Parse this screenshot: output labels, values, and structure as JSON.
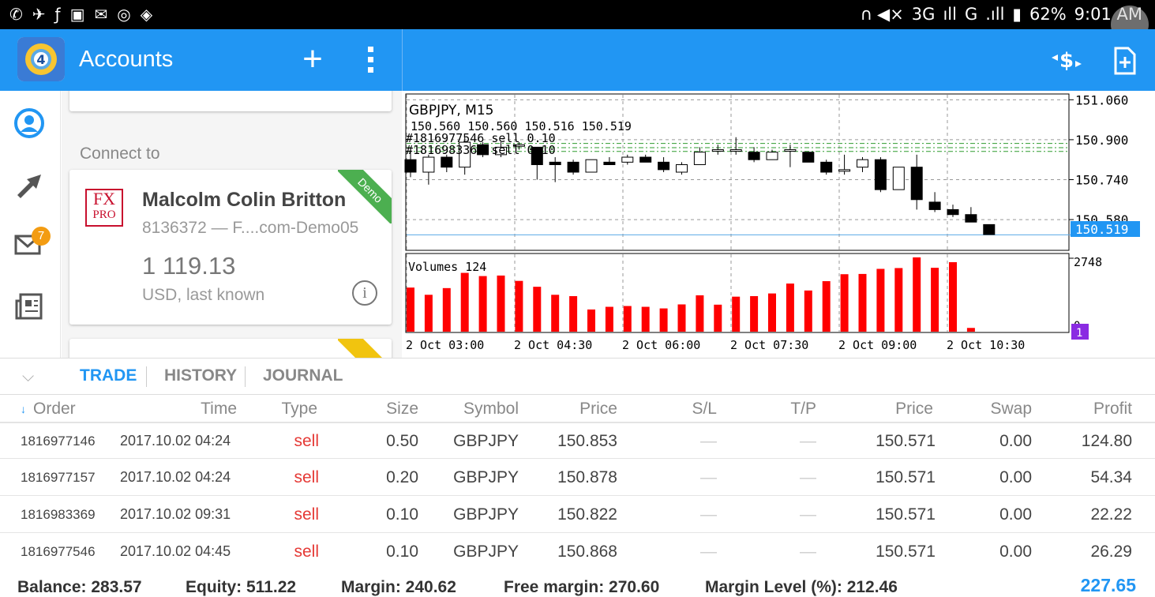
{
  "status_bar": {
    "left_icons": [
      "whatsapp-icon",
      "twitter-bird-icon",
      "fa-icon",
      "facebook-icon",
      "mail-icon",
      "instagram-icon",
      "app-icon"
    ],
    "network": "3G",
    "signal": "G",
    "battery": "62%",
    "time": "9:01 AM"
  },
  "toolbar": {
    "title": "Accounts",
    "add_label": "+",
    "more_label": "⋮"
  },
  "sidebar": {
    "mail_badge": "7"
  },
  "account": {
    "connect_label": "Connect to",
    "name": "Malcolm Colin  Britton",
    "id_server": "8136372 — F....com-Demo05",
    "balance": "1 119.13",
    "currency_note": "USD, last known",
    "ribbon": "Demo",
    "broker_logo_top": "FX",
    "broker_logo_bottom": "PRO"
  },
  "chart": {
    "symbol_timeframe": "GBPJPY, M15",
    "ohlc": "150.560 150.560 150.516 150.519",
    "order_line_1": "#1816977546 sell 0.10",
    "order_line_2": "#1816983369 sell 0.10",
    "volumes_label": "Volumes 124",
    "current_price": "150.519",
    "volume_max_label": "2748",
    "volume_zero_label": "0",
    "volume_marker": "1",
    "price_ticks": [
      "151.060",
      "150.900",
      "150.740",
      "150.580"
    ],
    "time_ticks": [
      "2 Oct 03:00",
      "2 Oct 04:30",
      "2 Oct 06:00",
      "2 Oct 07:30",
      "2 Oct 09:00",
      "2 Oct 10:30"
    ]
  },
  "chart_data": {
    "type": "candlestick",
    "title": "GBPJPY, M15",
    "ylim": [
      150.46,
      151.08
    ],
    "candles": [
      {
        "o": 150.82,
        "h": 150.86,
        "l": 150.75,
        "c": 150.77
      },
      {
        "o": 150.77,
        "h": 150.84,
        "l": 150.72,
        "c": 150.83
      },
      {
        "o": 150.83,
        "h": 150.84,
        "l": 150.77,
        "c": 150.79
      },
      {
        "o": 150.79,
        "h": 150.91,
        "l": 150.76,
        "c": 150.89
      },
      {
        "o": 150.88,
        "h": 150.89,
        "l": 150.83,
        "c": 150.84
      },
      {
        "o": 150.84,
        "h": 150.89,
        "l": 150.83,
        "c": 150.87
      },
      {
        "o": 150.88,
        "h": 150.89,
        "l": 150.86,
        "c": 150.88
      },
      {
        "o": 150.87,
        "h": 150.87,
        "l": 150.74,
        "c": 150.8
      },
      {
        "o": 150.81,
        "h": 150.83,
        "l": 150.73,
        "c": 150.8
      },
      {
        "o": 150.81,
        "h": 150.82,
        "l": 150.76,
        "c": 150.77
      },
      {
        "o": 150.77,
        "h": 150.82,
        "l": 150.77,
        "c": 150.82
      },
      {
        "o": 150.81,
        "h": 150.83,
        "l": 150.8,
        "c": 150.8
      },
      {
        "o": 150.81,
        "h": 150.84,
        "l": 150.8,
        "c": 150.83
      },
      {
        "o": 150.83,
        "h": 150.84,
        "l": 150.81,
        "c": 150.81
      },
      {
        "o": 150.81,
        "h": 150.83,
        "l": 150.77,
        "c": 150.78
      },
      {
        "o": 150.77,
        "h": 150.81,
        "l": 150.76,
        "c": 150.8
      },
      {
        "o": 150.8,
        "h": 150.87,
        "l": 150.8,
        "c": 150.85
      },
      {
        "o": 150.86,
        "h": 150.88,
        "l": 150.84,
        "c": 150.86
      },
      {
        "o": 150.86,
        "h": 150.91,
        "l": 150.84,
        "c": 150.86
      },
      {
        "o": 150.85,
        "h": 150.87,
        "l": 150.81,
        "c": 150.82
      },
      {
        "o": 150.82,
        "h": 150.86,
        "l": 150.82,
        "c": 150.85
      },
      {
        "o": 150.86,
        "h": 150.88,
        "l": 150.79,
        "c": 150.86
      },
      {
        "o": 150.85,
        "h": 150.85,
        "l": 150.81,
        "c": 150.81
      },
      {
        "o": 150.81,
        "h": 150.82,
        "l": 150.76,
        "c": 150.77
      },
      {
        "o": 150.78,
        "h": 150.84,
        "l": 150.76,
        "c": 150.78
      },
      {
        "o": 150.79,
        "h": 150.83,
        "l": 150.77,
        "c": 150.82
      },
      {
        "o": 150.82,
        "h": 150.83,
        "l": 150.69,
        "c": 150.7
      },
      {
        "o": 150.7,
        "h": 150.79,
        "l": 150.7,
        "c": 150.79
      },
      {
        "o": 150.79,
        "h": 150.84,
        "l": 150.62,
        "c": 150.66
      },
      {
        "o": 150.65,
        "h": 150.69,
        "l": 150.61,
        "c": 150.62
      },
      {
        "o": 150.62,
        "h": 150.64,
        "l": 150.59,
        "c": 150.6
      },
      {
        "o": 150.6,
        "h": 150.63,
        "l": 150.57,
        "c": 150.57
      },
      {
        "o": 150.56,
        "h": 150.56,
        "l": 150.52,
        "c": 150.52
      }
    ],
    "volumes": [
      1650,
      1380,
      1630,
      2200,
      2080,
      2100,
      1900,
      1680,
      1380,
      1330,
      830,
      930,
      960,
      930,
      870,
      1020,
      1360,
      1010,
      1310,
      1330,
      1430,
      1800,
      1540,
      1890,
      2150,
      2160,
      2350,
      2380,
      2780,
      2390,
      2600,
      140,
      0
    ],
    "volume_max": 2748,
    "lines": {
      "order_levels": [
        150.885,
        150.868,
        150.853
      ],
      "current_price": 150.519
    }
  },
  "tabs": [
    {
      "label": "TRADE",
      "active": true
    },
    {
      "label": "HISTORY",
      "active": false
    },
    {
      "label": "JOURNAL",
      "active": false
    }
  ],
  "table": {
    "headers": [
      "Order",
      "Time",
      "Type",
      "Size",
      "Symbol",
      "Price",
      "S/L",
      "T/P",
      "Price",
      "Swap",
      "Profit"
    ],
    "rows": [
      [
        "1816977146",
        "2017.10.02 04:24",
        "sell",
        "0.50",
        "GBPJPY",
        "150.853",
        "—",
        "—",
        "150.571",
        "0.00",
        "124.80"
      ],
      [
        "1816977157",
        "2017.10.02 04:24",
        "sell",
        "0.20",
        "GBPJPY",
        "150.878",
        "—",
        "—",
        "150.571",
        "0.00",
        "54.34"
      ],
      [
        "1816983369",
        "2017.10.02 09:31",
        "sell",
        "0.10",
        "GBPJPY",
        "150.822",
        "—",
        "—",
        "150.571",
        "0.00",
        "22.22"
      ],
      [
        "1816977546",
        "2017.10.02 04:45",
        "sell",
        "0.10",
        "GBPJPY",
        "150.868",
        "—",
        "—",
        "150.571",
        "0.00",
        "26.29"
      ]
    ]
  },
  "summary": {
    "balance": "Balance: 283.57",
    "equity": "Equity: 511.22",
    "margin": "Margin: 240.62",
    "free_margin": "Free margin: 270.60",
    "margin_level": "Margin Level (%): 212.46",
    "total_profit": "227.65"
  }
}
